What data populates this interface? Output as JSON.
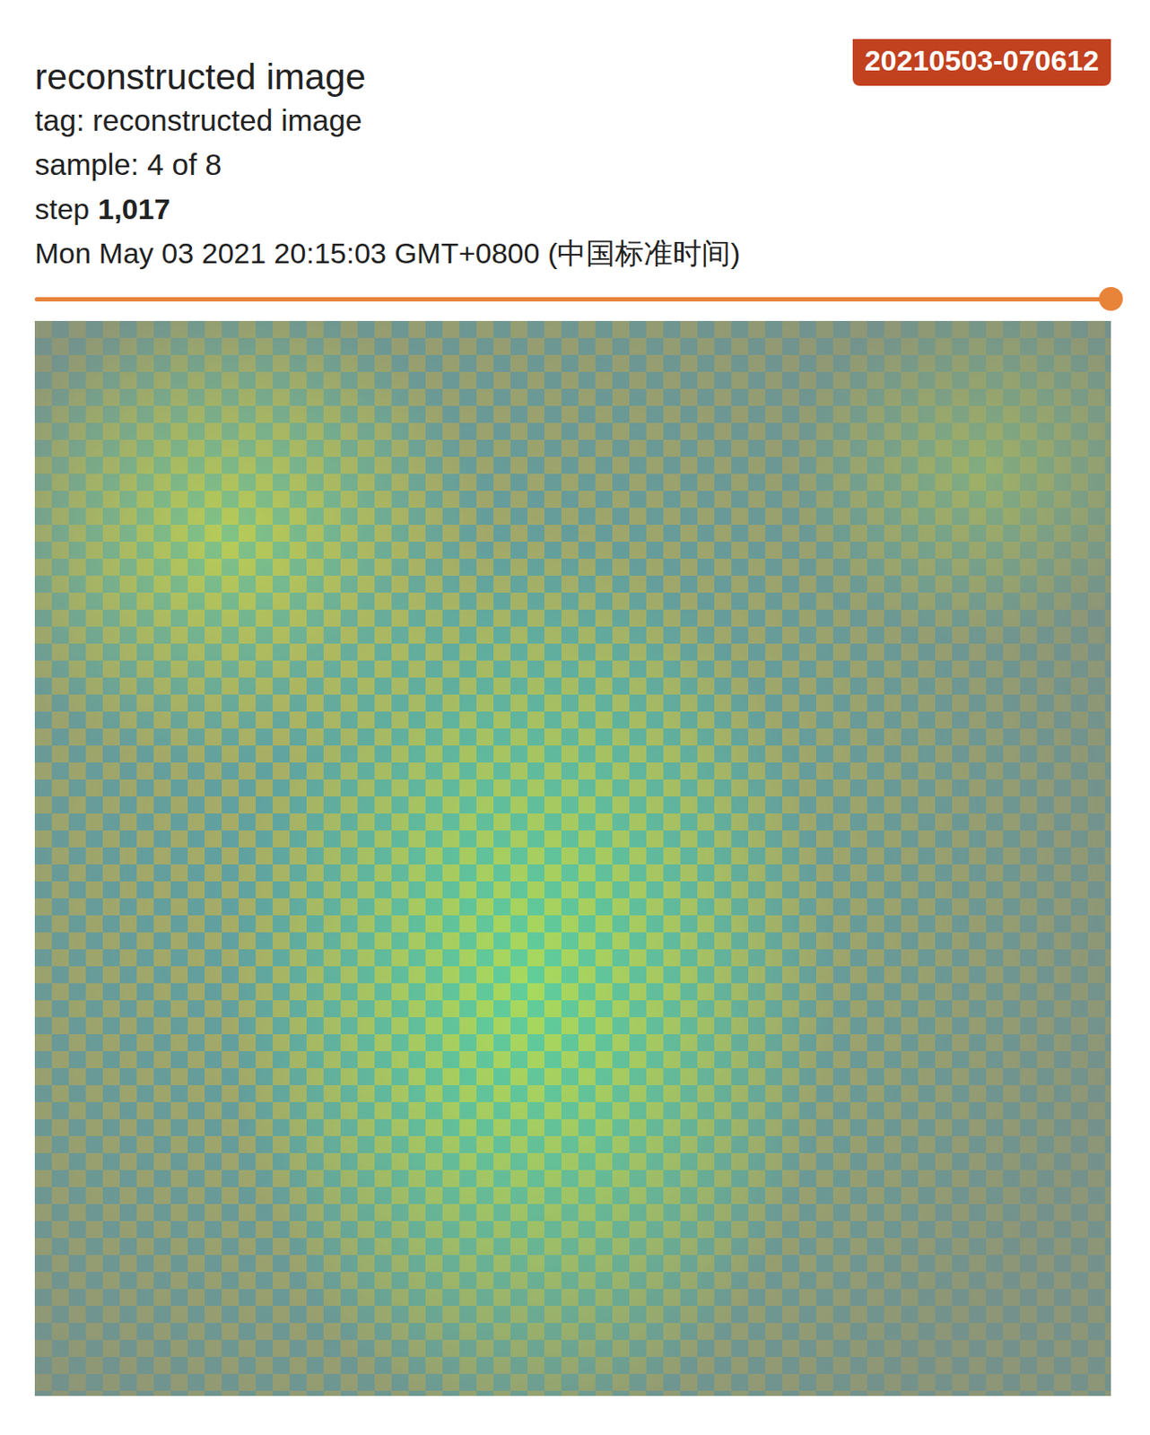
{
  "card": {
    "title": "reconstructed image",
    "tag": "tag: reconstructed image",
    "sample": "sample: 4 of 8",
    "step_label": "step",
    "step": "1,017",
    "time": "Mon May 03 2021 20:15:03 GMT+0800 (中国标准时间)",
    "run_badge": "20210503-070612"
  },
  "step_slider": {
    "level": 1.0
  }
}
